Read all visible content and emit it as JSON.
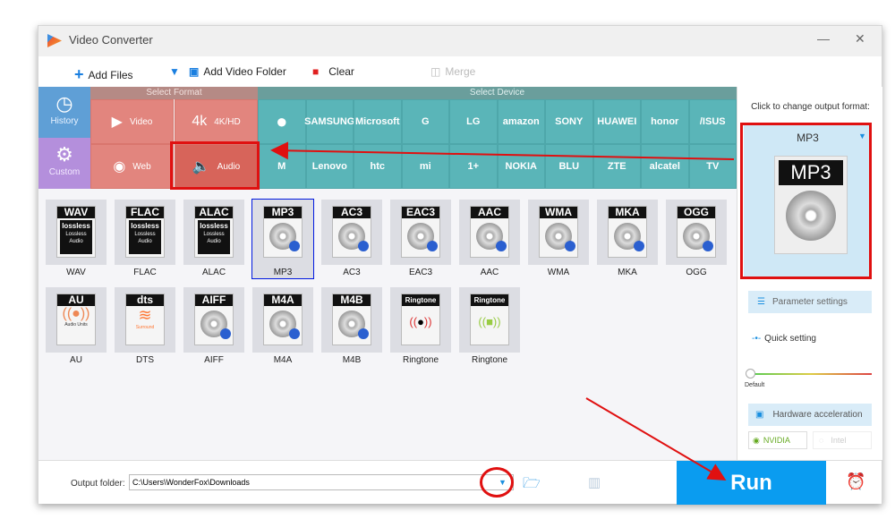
{
  "window": {
    "title": "Video Converter",
    "minimize": "—",
    "close": "✕"
  },
  "toolbar": {
    "add_files": "Add Files",
    "add_video_folder": "Add Video Folder",
    "clear": "Clear",
    "merge": "Merge"
  },
  "nav": {
    "history": "History",
    "custom": "Custom",
    "select_format": "Select Format",
    "select_device": "Select Device",
    "formats": [
      {
        "label": "Video",
        "icon": "▶"
      },
      {
        "label": "4K/HD",
        "icon": "4k"
      },
      {
        "label": "Web",
        "icon": "◉"
      },
      {
        "label": "Audio",
        "icon": "🔈"
      }
    ],
    "devices_row1": [
      "",
      "SAMSUNG",
      "Microsoft",
      "G",
      "LG",
      "amazon",
      "SONY",
      "HUAWEI",
      "honor",
      "/ISUS"
    ],
    "devices_row2": [
      "M",
      "Lenovo",
      "htc",
      "mi",
      "1+",
      "NOKIA",
      "BLU",
      "ZTE",
      "alcatel",
      "TV"
    ]
  },
  "formats": [
    {
      "label": "WAV",
      "header": "WAV",
      "type": "lossless"
    },
    {
      "label": "FLAC",
      "header": "FLAC",
      "type": "lossless"
    },
    {
      "label": "ALAC",
      "header": "ALAC",
      "type": "lossless"
    },
    {
      "label": "MP3",
      "header": "MP3",
      "type": "disc",
      "selected": true
    },
    {
      "label": "AC3",
      "header": "AC3",
      "type": "disc"
    },
    {
      "label": "EAC3",
      "header": "EAC3",
      "type": "disc"
    },
    {
      "label": "AAC",
      "header": "AAC",
      "type": "disc"
    },
    {
      "label": "WMA",
      "header": "WMA",
      "type": "disc"
    },
    {
      "label": "MKA",
      "header": "MKA",
      "type": "disc"
    },
    {
      "label": "OGG",
      "header": "OGG",
      "type": "disc"
    },
    {
      "label": "AU",
      "header": "AU",
      "type": "au"
    },
    {
      "label": "DTS",
      "header": "dts",
      "type": "dts"
    },
    {
      "label": "AIFF",
      "header": "AIFF",
      "type": "disc"
    },
    {
      "label": "M4A",
      "header": "M4A",
      "type": "disc"
    },
    {
      "label": "M4B",
      "header": "M4B",
      "type": "disc"
    },
    {
      "label": "Ringtone",
      "header": "Ringtone",
      "type": "apple"
    },
    {
      "label": "Ringtone",
      "header": "Ringtone",
      "type": "android"
    }
  ],
  "lossless_text": {
    "badge": "lossless",
    "line1": "Lossless",
    "line2": "Audio"
  },
  "au_text": "Audio Units",
  "dts_text": "Surround",
  "right": {
    "hint": "Click to change output format:",
    "format": "MP3",
    "parameter_settings": "Parameter settings",
    "quick_setting": "Quick setting",
    "slider_label": "Default",
    "slider_value": 0,
    "hardware_acceleration": "Hardware acceleration",
    "nvidia": "NVIDIA",
    "intel": "Intel"
  },
  "bottom": {
    "output_label": "Output folder:",
    "output_path": "C:\\Users\\WonderFox\\Downloads",
    "run": "Run"
  },
  "colors": {
    "accent": "#0a9cf0",
    "format_panel": "#e2857e",
    "device_panel": "#5ab5b8",
    "annotation": "#e01010"
  }
}
